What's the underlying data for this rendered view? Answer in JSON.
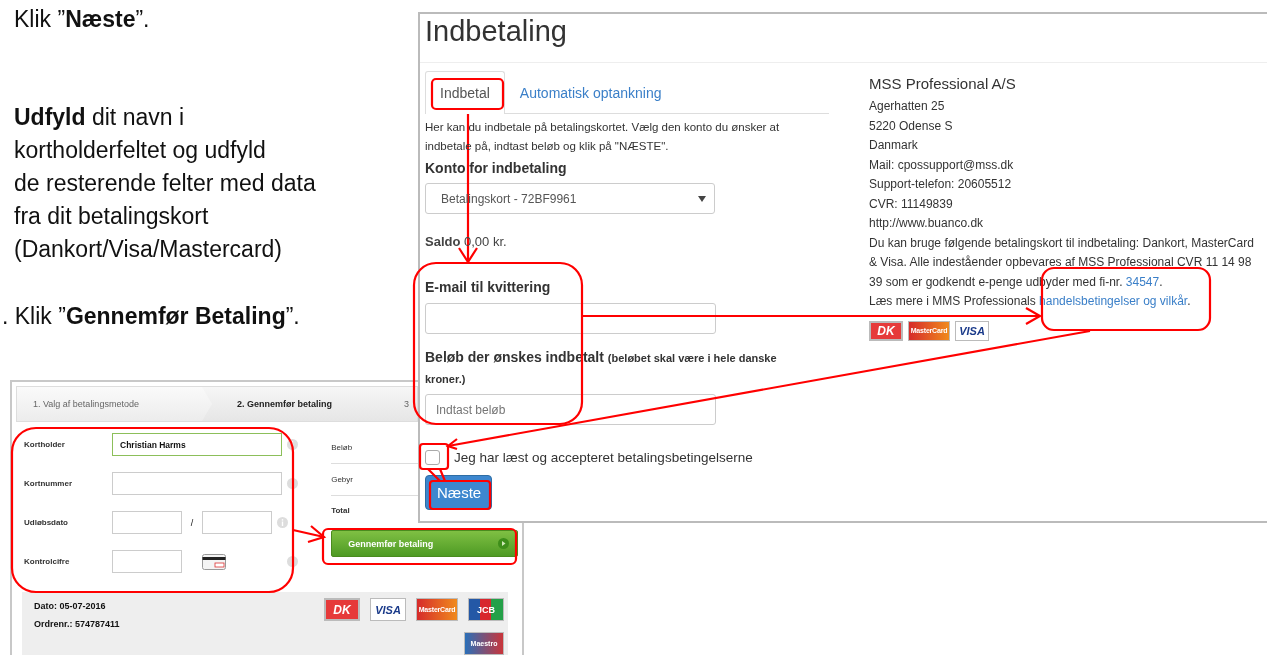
{
  "instructions": {
    "step_next": "Klik ”**Næste**”.",
    "fill_lines": [
      "**Udfyld** dit navn i",
      "kortholderfeltet og udfyld",
      "de resterende felter med data",
      "fra dit betalingskort",
      "(Dankort/Visa/Mastercard)"
    ],
    "step_pay": ". Klik ”**Gennemfør Betaling**”."
  },
  "checkout_window": {
    "steps": [
      {
        "label": "1. Valg af betalingsmetode",
        "selected": false
      },
      {
        "label": "2. Gennemfør betaling",
        "selected": true
      },
      {
        "label": "3",
        "selected": false
      }
    ],
    "fields": [
      {
        "kind": "text",
        "label": "Kortholder",
        "value": "Christian Harms",
        "valid": true
      },
      {
        "kind": "text",
        "label": "Kortnummer",
        "valid": false
      },
      {
        "kind": "expiry",
        "label": "Udløbsdato",
        "separator": "/",
        "valid": false
      },
      {
        "kind": "cvc",
        "label": "Kontrolcifre",
        "valid": false
      }
    ],
    "summary": [
      {
        "kind": "line",
        "label": "Beløb"
      },
      {
        "kind": "line",
        "label": "Gebyr"
      },
      {
        "kind": "total",
        "label": "Total"
      }
    ],
    "pay_button": "Gennemfør betaling",
    "date": "Dato: 05-07-2016",
    "order_number": "Ordrenr.: 574787411",
    "card_logos": [
      {
        "kind": "dankort",
        "label": "DK"
      },
      {
        "kind": "visa",
        "label": "VISA"
      },
      {
        "kind": "mastercard",
        "label": "MasterCard"
      },
      {
        "kind": "jcb",
        "label": "JCB"
      },
      {
        "kind": "maestro",
        "label": "Maestro"
      }
    ]
  },
  "payment_window": {
    "title": "Indbetaling",
    "tabs": [
      {
        "label": "Indbetal",
        "selected": true
      },
      {
        "label": "Automatisk optankning",
        "selected": false
      }
    ],
    "description": "Her kan du indbetale på betalingskortet. Vælg den konto du ønsker at indbetale på, indtast beløb og klik på \"NÆSTE\".",
    "account_label": "Konto for indbetaling",
    "account_select": "Betalingskort - 72BF9961",
    "balance": "**Saldo** 0,00 kr.",
    "email_label": "E-mail til kvittering",
    "amount_label": "Beløb der ønskes indbetalt",
    "amount_hint": "(beløbet skal være i hele danske kroner.)",
    "amount_field": {
      "placeholder": "Indtast beløb"
    },
    "terms": {
      "label": "Jeg har læst og accepteret betalingsbetingelserne",
      "checked": false
    },
    "next_button": "Næste",
    "merchant": {
      "name": "MSS Professional A/S",
      "lines": [
        "Agerhatten 25",
        "5220 Odense S",
        "Danmark",
        "Mail: cpossupport@mss.dk",
        "Support-telefon: 20605512",
        "CVR: 11149839",
        "http://www.buanco.dk"
      ],
      "notice": {
        "text": "Du kan bruge følgende betalingskort til indbetaling: Dankort, MasterCard & Visa. Alle indeståender opbevares af MSS Professional CVR 11 14 98 39 som er godkendt e-penge udbyder med fi-nr.",
        "link": "34547",
        "end": "."
      },
      "terms_note": {
        "text": "Læs mere i MMS Professionals",
        "link": "handelsbetingelser og vilkår",
        "end": "."
      },
      "card_logos": [
        {
          "kind": "dankort",
          "label": "DK"
        },
        {
          "kind": "mastercard",
          "label": "MasterCard"
        },
        {
          "kind": "visa",
          "label": "VISA"
        }
      ]
    }
  }
}
